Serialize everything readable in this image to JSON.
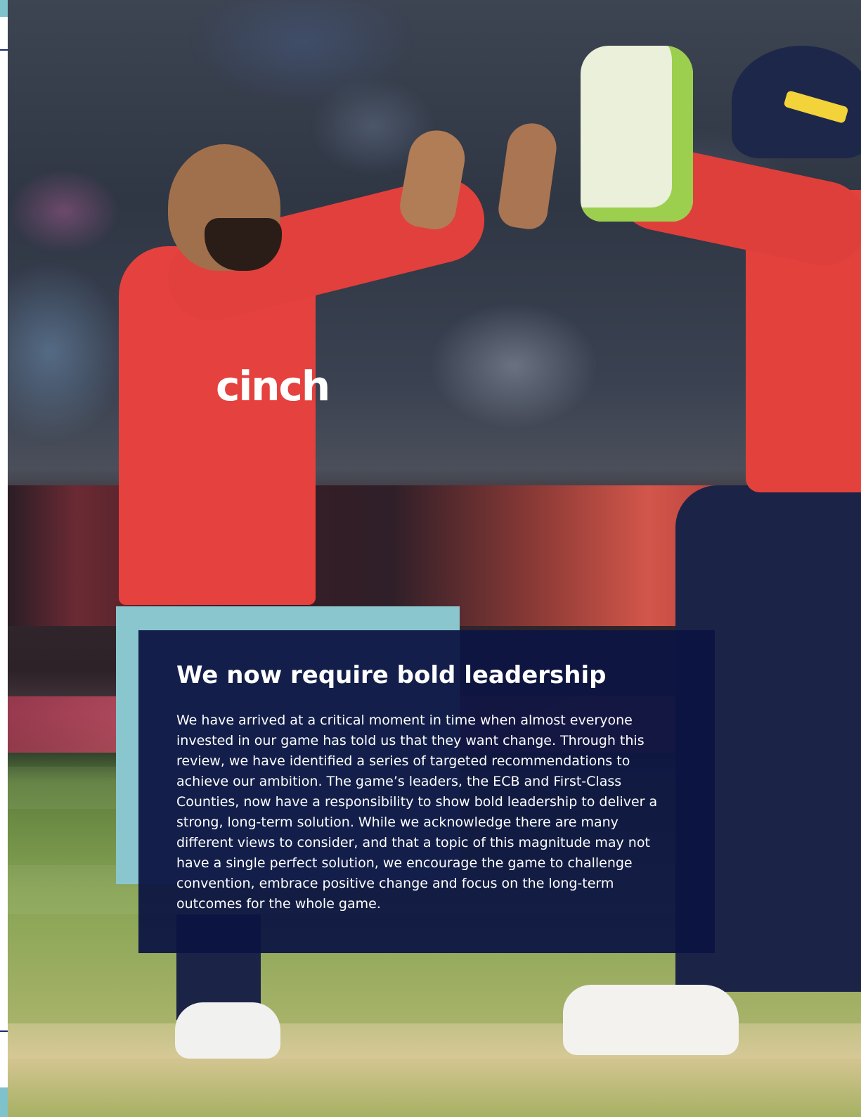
{
  "panel": {
    "title": "We now require bold leadership",
    "body": "We have arrived at a critical moment in time when almost everyone invested in our game has told us that they want change. Through this review, we have identified a series of targeted recommendations to achieve our ambition. The game’s leaders, the ECB and First-Class Counties, now have a responsibility to show bold leadership to deliver a strong, long-term solution. While we acknowledge there are many different views to consider, and that a topic of this magnitude may not have a single perfect solution, we encourage the game to challenge convention, embrace positive change and focus on the long-term outcomes for the whole game."
  },
  "photo": {
    "shirt_sponsor": "cinch"
  },
  "colors": {
    "panel_background": "#0c1442",
    "panel_accent": "#8ac6cd",
    "gutter_accent": "#7fc2cb",
    "gutter_rule": "#1b2a6b",
    "shirt_red": "#e5413e",
    "trousers_navy": "#1b2447"
  }
}
